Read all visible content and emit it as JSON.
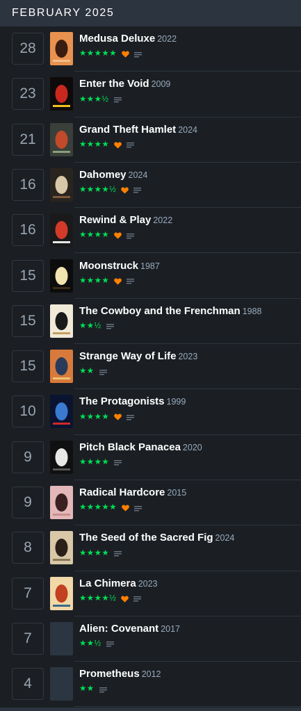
{
  "header": {
    "month_label": "FEBRUARY 2025"
  },
  "colors": {
    "star": "#00e054",
    "heart": "#ff8000",
    "year": "#99aabb",
    "title": "#ffffff",
    "day": "#9aa5b1"
  },
  "entries": [
    {
      "day": "28",
      "title": "Medusa Deluxe",
      "year": "2022",
      "stars": "★★★★★",
      "liked": true,
      "has_review": true,
      "poster": {
        "bg": "#e9924f",
        "fg": "#3b1c10",
        "accent": "#f4c08a"
      }
    },
    {
      "day": "23",
      "title": "Enter the Void",
      "year": "2009",
      "stars": "★★★½",
      "liked": false,
      "has_review": true,
      "poster": {
        "bg": "#0f0a0a",
        "fg": "#c9281f",
        "accent": "#f0c020"
      }
    },
    {
      "day": "21",
      "title": "Grand Theft Hamlet",
      "year": "2024",
      "stars": "★★★★",
      "liked": true,
      "has_review": true,
      "poster": {
        "bg": "#3a3f3a",
        "fg": "#c14a2a",
        "accent": "#8aa07a"
      }
    },
    {
      "day": "16",
      "title": "Dahomey",
      "year": "2024",
      "stars": "★★★★½",
      "liked": true,
      "has_review": true,
      "poster": {
        "bg": "#2a241e",
        "fg": "#d8c8a8",
        "accent": "#7a5a3a"
      }
    },
    {
      "day": "16",
      "title": "Rewind & Play",
      "year": "2022",
      "stars": "★★★★",
      "liked": true,
      "has_review": true,
      "poster": {
        "bg": "#1a1a1a",
        "fg": "#d23a2a",
        "accent": "#e8e8e8"
      }
    },
    {
      "day": "15",
      "title": "Moonstruck",
      "year": "1987",
      "stars": "★★★★",
      "liked": true,
      "has_review": true,
      "poster": {
        "bg": "#0c0c0c",
        "fg": "#f2e4b0",
        "accent": "#3a2a18"
      }
    },
    {
      "day": "15",
      "title": "The Cowboy and the Frenchman",
      "year": "1988",
      "stars": "★★½",
      "liked": false,
      "has_review": true,
      "poster": {
        "bg": "#f1ead8",
        "fg": "#1a1a1a",
        "accent": "#c4a060"
      }
    },
    {
      "day": "15",
      "title": "Strange Way of Life",
      "year": "2023",
      "stars": "★★",
      "liked": false,
      "has_review": true,
      "poster": {
        "bg": "#d87a3c",
        "fg": "#2a3a5a",
        "accent": "#f0c070"
      }
    },
    {
      "day": "10",
      "title": "The Protagonists",
      "year": "1999",
      "stars": "★★★★",
      "liked": true,
      "has_review": true,
      "poster": {
        "bg": "#0a1430",
        "fg": "#3a7ad0",
        "accent": "#d02a2a"
      }
    },
    {
      "day": "9",
      "title": "Pitch Black Panacea",
      "year": "2020",
      "stars": "★★★★",
      "liked": false,
      "has_review": true,
      "poster": {
        "bg": "#101010",
        "fg": "#e8e8e8",
        "accent": "#555555"
      }
    },
    {
      "day": "9",
      "title": "Radical Hardcore",
      "year": "2015",
      "stars": "★★★★★",
      "liked": true,
      "has_review": true,
      "poster": {
        "bg": "#e4b8b8",
        "fg": "#3a2020",
        "accent": "#c89090"
      }
    },
    {
      "day": "8",
      "title": "The Seed of the Sacred Fig",
      "year": "2024",
      "stars": "★★★★",
      "liked": false,
      "has_review": true,
      "poster": {
        "bg": "#d8c8a8",
        "fg": "#2a2018",
        "accent": "#8a7a5a"
      }
    },
    {
      "day": "7",
      "title": "La Chimera",
      "year": "2023",
      "stars": "★★★★½",
      "liked": true,
      "has_review": true,
      "poster": {
        "bg": "#f0d8a8",
        "fg": "#c04020",
        "accent": "#3a6a8a"
      }
    },
    {
      "day": "7",
      "title": "Alien: Covenant",
      "year": "2017",
      "stars": "★★½",
      "liked": false,
      "has_review": true,
      "poster": {
        "bg": "#2b3642",
        "fg": "#2b3642",
        "accent": "#2b3642"
      }
    },
    {
      "day": "4",
      "title": "Prometheus",
      "year": "2012",
      "stars": "★★",
      "liked": false,
      "has_review": true,
      "poster": {
        "bg": "#2b3642",
        "fg": "#2b3642",
        "accent": "#2b3642"
      }
    }
  ]
}
